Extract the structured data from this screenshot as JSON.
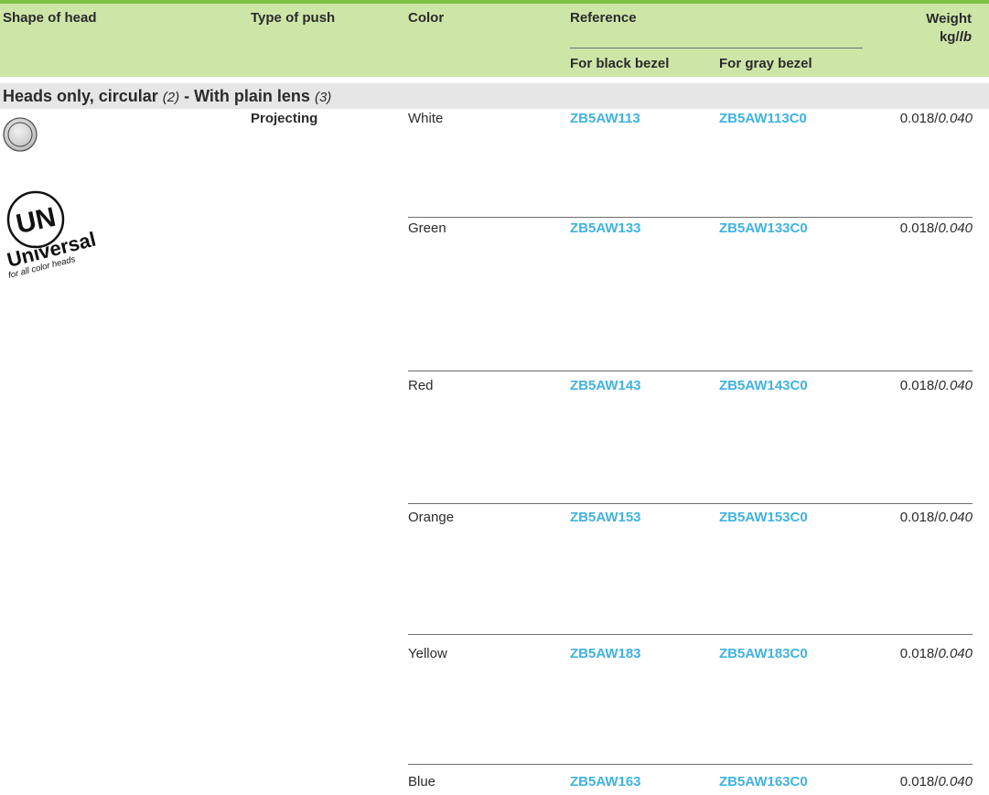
{
  "header": {
    "shape_of_head": "Shape of head",
    "type_of_push": "Type of push",
    "color": "Color",
    "reference": "Reference",
    "for_black_bezel": "For black bezel",
    "for_gray_bezel": "For gray bezel",
    "weight_line1": "Weight",
    "weight_unit_kg": "kg/",
    "weight_unit_lb": "lb"
  },
  "section": {
    "title_part1": "Heads only, circular",
    "note1": "(2)",
    "title_part2": " - With plain lens",
    "note2": "(3)"
  },
  "push_type": "Projecting",
  "logo": {
    "badge": "UN",
    "word": "Universal",
    "tagline": "for all color heads"
  },
  "rows": [
    {
      "color": "White",
      "ref_black": "ZB5AW113",
      "ref_gray": "ZB5AW113C0",
      "weight_kg": "0.018/",
      "weight_lb": "0.040"
    },
    {
      "color": "Green",
      "ref_black": "ZB5AW133",
      "ref_gray": "ZB5AW133C0",
      "weight_kg": "0.018/",
      "weight_lb": "0.040"
    },
    {
      "color": "Red",
      "ref_black": "ZB5AW143",
      "ref_gray": "ZB5AW143C0",
      "weight_kg": "0.018/",
      "weight_lb": "0.040"
    },
    {
      "color": "Orange",
      "ref_black": "ZB5AW153",
      "ref_gray": "ZB5AW153C0",
      "weight_kg": "0.018/",
      "weight_lb": "0.040"
    },
    {
      "color": "Yellow",
      "ref_black": "ZB5AW183",
      "ref_gray": "ZB5AW183C0",
      "weight_kg": "0.018/",
      "weight_lb": "0.040"
    },
    {
      "color": "Blue",
      "ref_black": "ZB5AW163",
      "ref_gray": "ZB5AW163C0",
      "weight_kg": "0.018/",
      "weight_lb": "0.040"
    }
  ],
  "colors": {
    "header_bg": "#cde6a8",
    "accent_bar": "#7cc243",
    "section_bg": "#e6e6e6",
    "reference_text": "#3fb3e2"
  }
}
